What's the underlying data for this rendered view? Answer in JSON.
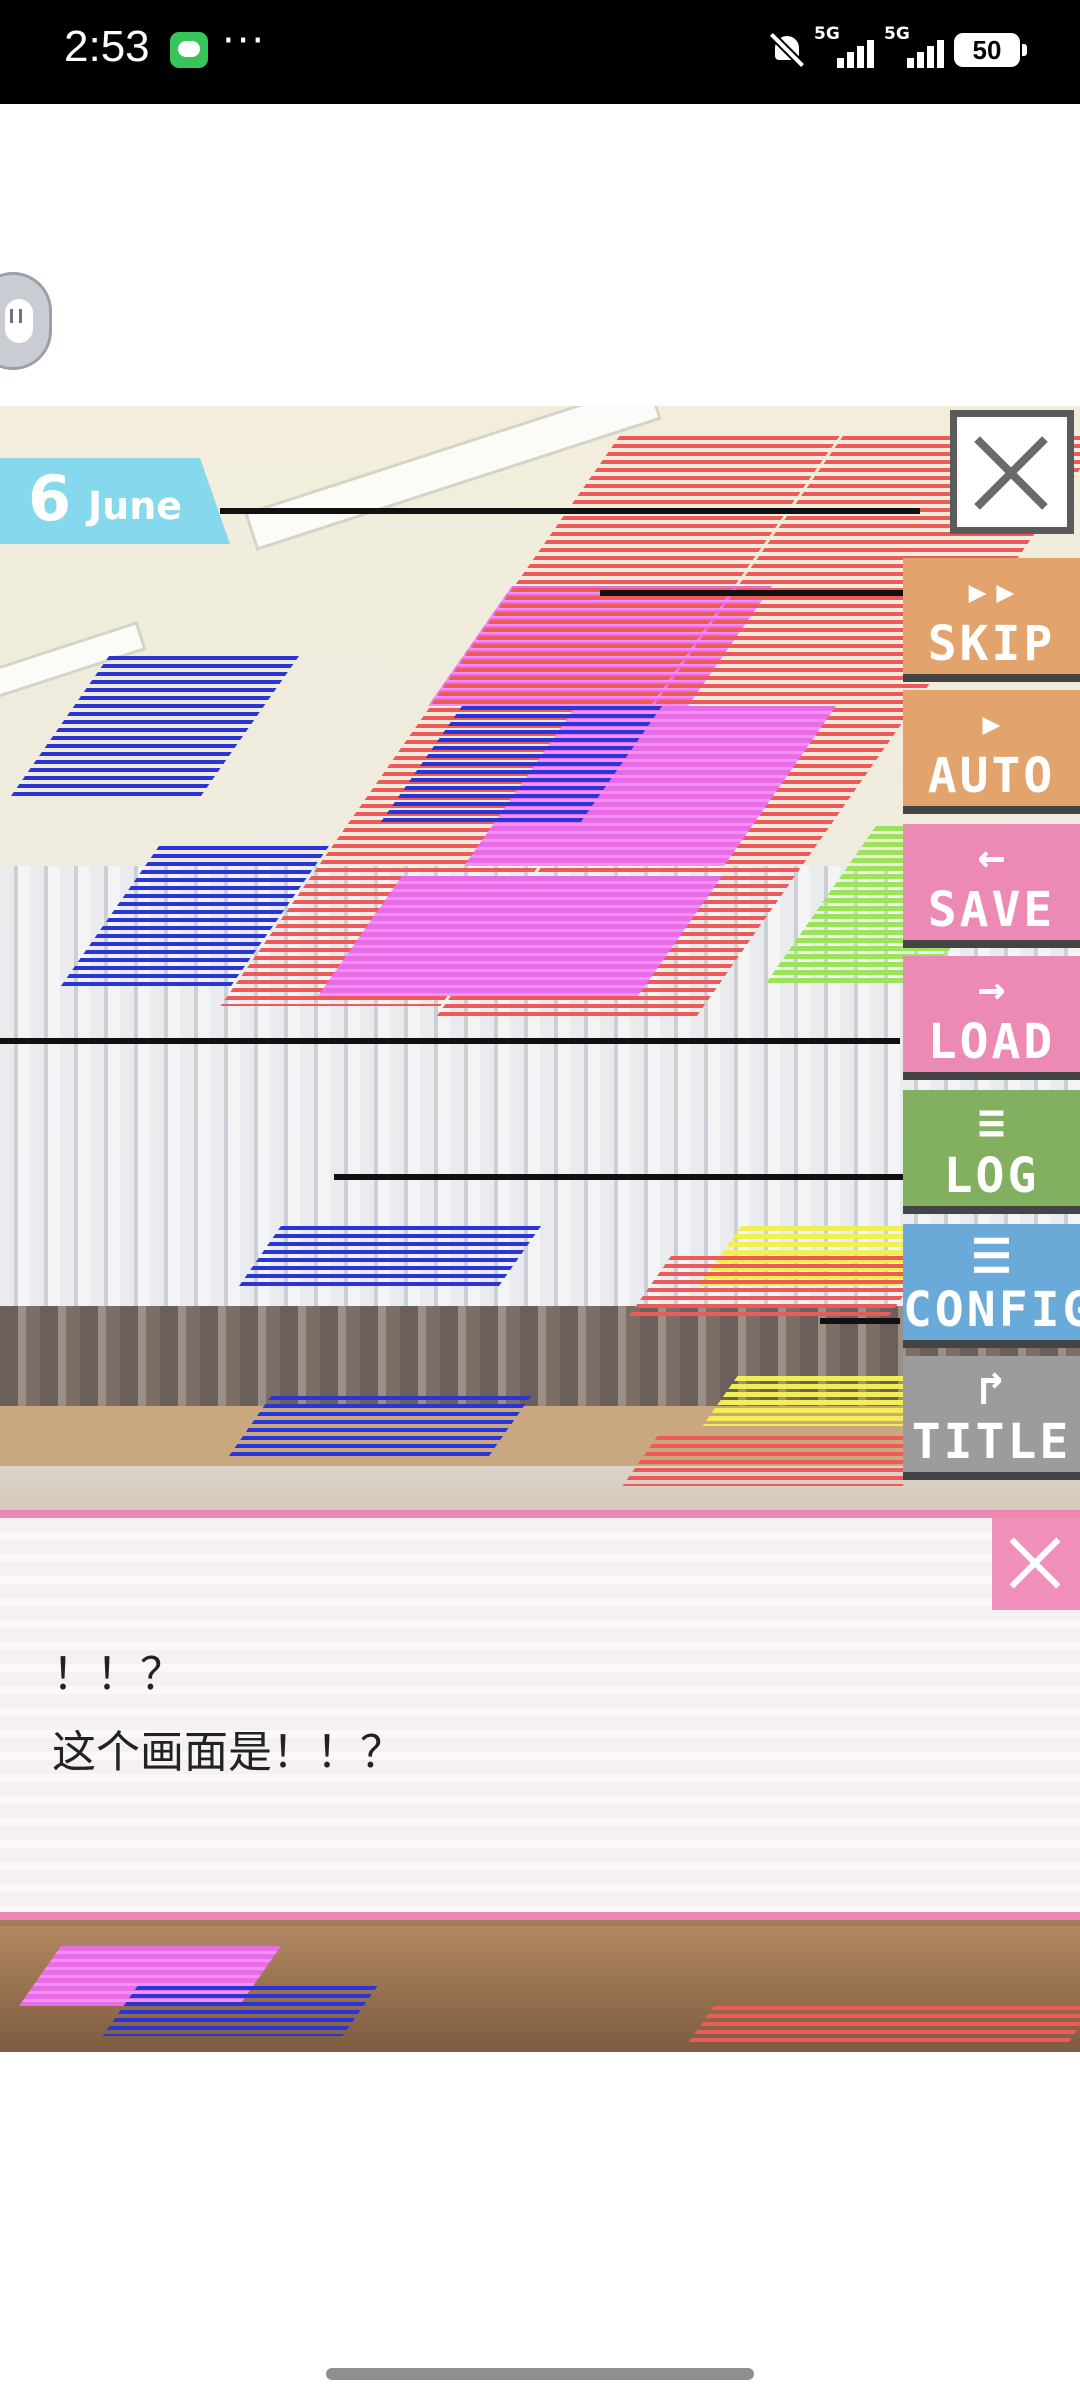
{
  "status_bar": {
    "time": "2:53",
    "more": "···",
    "network_1": "5G",
    "network_2": "5G",
    "battery": "50"
  },
  "game": {
    "date": {
      "day": "6",
      "month": "June"
    },
    "menu": [
      {
        "id": "skip",
        "icon": "▸▸",
        "label": "SKIP",
        "color": "#e2a46c"
      },
      {
        "id": "auto",
        "icon": "▸",
        "label": "AUTO",
        "color": "#e2a46c"
      },
      {
        "id": "save",
        "icon": "←",
        "label": "SAVE",
        "color": "#ec8ab5"
      },
      {
        "id": "load",
        "icon": "→",
        "label": "LOAD",
        "color": "#ec8ab5"
      },
      {
        "id": "log",
        "icon": "≡",
        "label": "LOG",
        "color": "#82b060"
      },
      {
        "id": "config",
        "icon": "☰",
        "label": "CONFIG",
        "color": "#6aaad8"
      },
      {
        "id": "title",
        "icon": "↱",
        "label": "TITLE",
        "color": "#9c9c9c"
      }
    ],
    "dialog": {
      "line1": "！！？",
      "line2": "这个画面是！！？"
    }
  }
}
